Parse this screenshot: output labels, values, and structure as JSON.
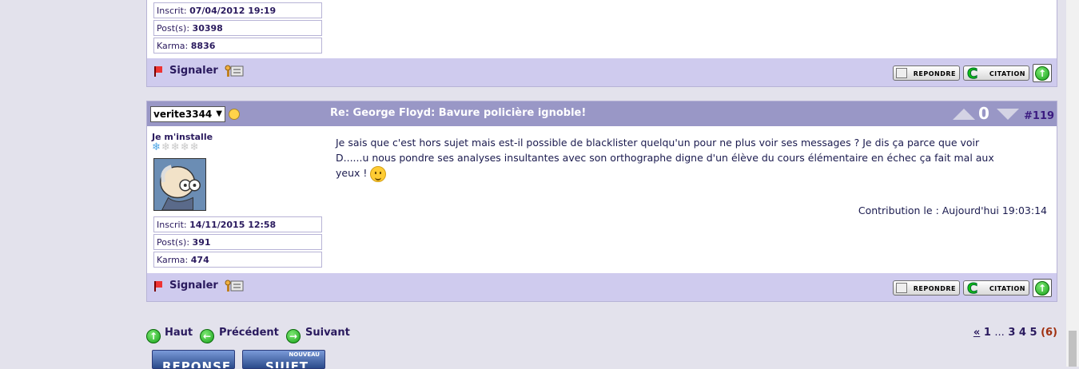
{
  "prev_post": {
    "registered_label": "Inscrit:",
    "registered_value": "07/04/2012 19:19",
    "posts_label": "Post(s):",
    "posts_value": "30398",
    "karma_label": "Karma:",
    "karma_value": "8836",
    "report_label": "Signaler",
    "reply_label": "REPONDRE",
    "cite_label": "CITATION"
  },
  "post": {
    "author": "verite3344",
    "title": "Re: George Floyd: Bavure policière ignoble!",
    "vote_count": "0",
    "number": "#119",
    "rank": "Je m'installe",
    "rank_level_of_5": 1,
    "body_line1": "Je sais que c'est hors sujet mais est-il possible de blacklister quelqu'un pour ne plus voir ses messages ? Je dis ça parce que voir",
    "body_line2": "D......u nous pondre ses analyses insultantes avec son orthographe digne d'un élève du cours élémentaire en échec ça fait mal aux",
    "body_line3": "yeux !",
    "contribution": "Contribution le : Aujourd'hui 19:03:14",
    "registered_label": "Inscrit:",
    "registered_value": "14/11/2015 12:58",
    "posts_label": "Post(s):",
    "posts_value": "391",
    "karma_label": "Karma:",
    "karma_value": "474",
    "report_label": "Signaler",
    "reply_label": "REPONDRE",
    "cite_label": "CITATION"
  },
  "nav": {
    "top_label": "Haut",
    "prev_label": "Précédent",
    "next_label": "Suivant"
  },
  "pager": {
    "first": "«",
    "p1": "1",
    "dots": "...",
    "p3": "3",
    "p4": "4",
    "p5": "5",
    "current": "(6)"
  },
  "bottom_buttons": {
    "reply_label": "REPONSE",
    "new_top": "NOUVEAU",
    "new_main": "SUJET"
  },
  "colors": {
    "header_bg": "#9997c6",
    "footer_bg": "#cfcbee",
    "text": "#2a1a5e",
    "accent_current_page": "#a03010"
  }
}
